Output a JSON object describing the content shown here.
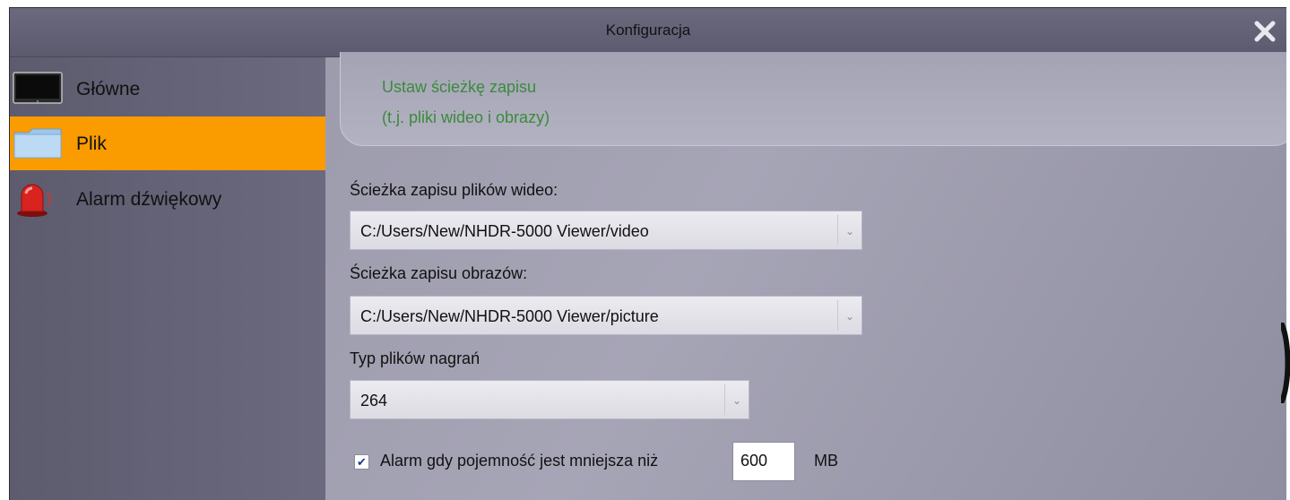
{
  "window": {
    "title": "Konfiguracja"
  },
  "sidebar": {
    "items": [
      {
        "label": "Główne",
        "icon": "monitor-icon",
        "active": false
      },
      {
        "label": "Plik",
        "icon": "folder-icon",
        "active": true
      },
      {
        "label": "Alarm dźwiękowy",
        "icon": "alarm-siren-icon",
        "active": false
      }
    ]
  },
  "header": {
    "line1": "Ustaw ścieżkę zapisu",
    "line2": "(t.j. pliki wideo i obrazy)",
    "color": "#3b8a3b"
  },
  "form": {
    "video_path_label": "Ścieżka zapisu plików wideo:",
    "video_path_value": "C:/Users/New/NHDR-5000 Viewer/video",
    "picture_path_label": "Ścieżka zapisu obrazów:",
    "picture_path_value": "C:/Users/New/NHDR-5000 Viewer/picture",
    "record_type_label": "Typ plików nagrań",
    "record_type_value": "264",
    "alarm_checked": true,
    "alarm_label": "Alarm gdy pojemność jest mniejsza niż",
    "alarm_value": "600",
    "alarm_unit": "MB"
  },
  "colors": {
    "active_item": "#fa9b00",
    "title_bar": "#5f5e72",
    "content_bg": "#a09fb0"
  }
}
